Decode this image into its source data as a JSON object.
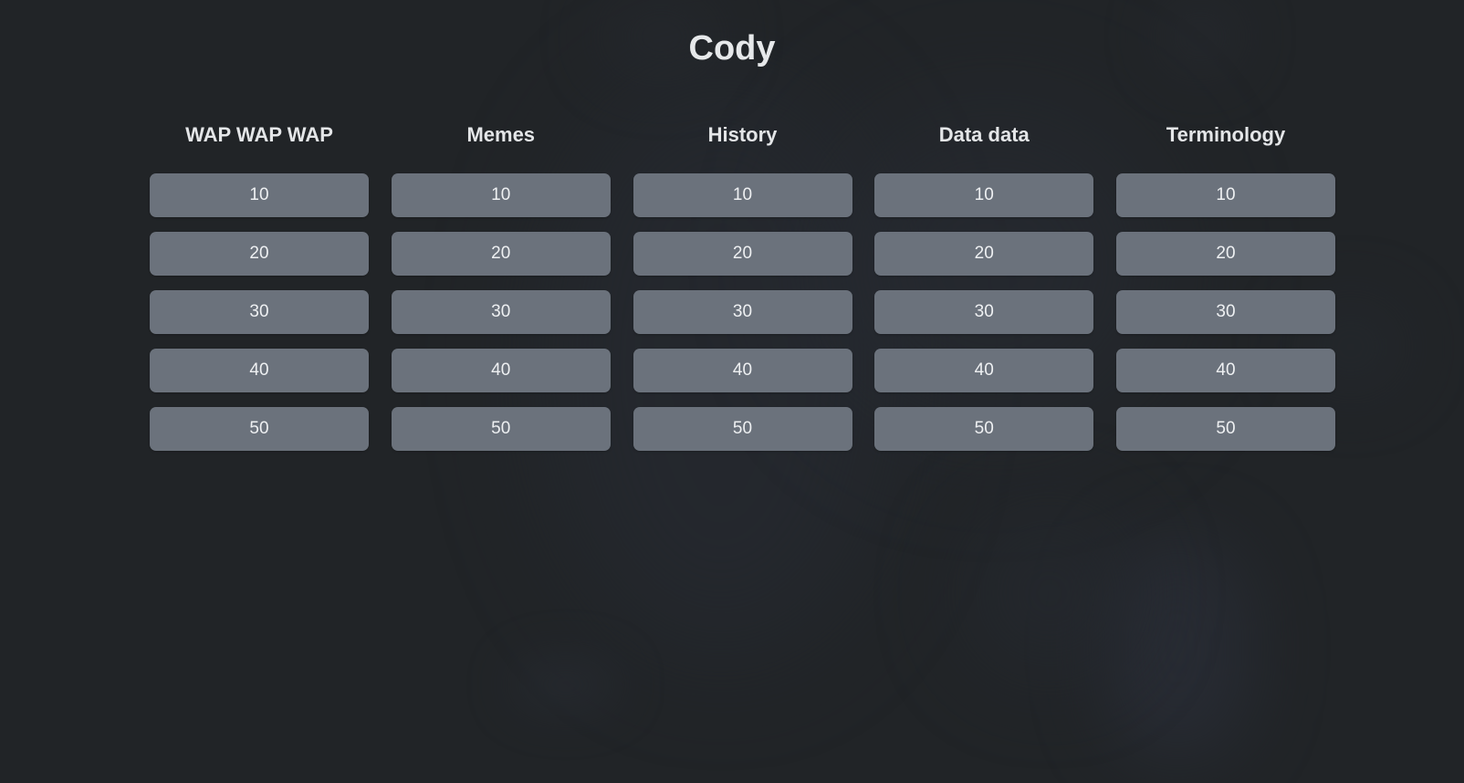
{
  "page": {
    "title": "Cody"
  },
  "theme": {
    "background": "#212427",
    "tile": "#6b727c",
    "text": "#e6e8ea"
  },
  "board": {
    "categories": [
      {
        "title": "WAP WAP WAP",
        "values": [
          "10",
          "20",
          "30",
          "40",
          "50"
        ]
      },
      {
        "title": "Memes",
        "values": [
          "10",
          "20",
          "30",
          "40",
          "50"
        ]
      },
      {
        "title": "History",
        "values": [
          "10",
          "20",
          "30",
          "40",
          "50"
        ]
      },
      {
        "title": "Data data",
        "values": [
          "10",
          "20",
          "30",
          "40",
          "50"
        ]
      },
      {
        "title": "Terminology",
        "values": [
          "10",
          "20",
          "30",
          "40",
          "50"
        ]
      }
    ]
  }
}
